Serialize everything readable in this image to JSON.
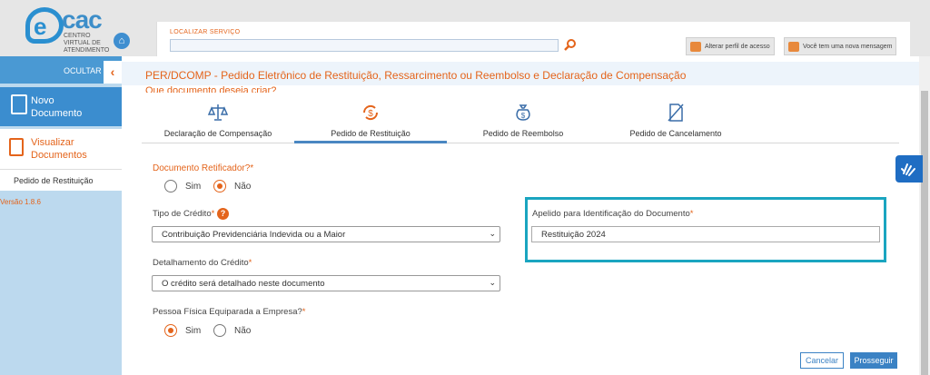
{
  "header": {
    "logo_text": "cac",
    "logo_letter": "e",
    "logo_subtitle": "CENTRO VIRTUAL DE ATENDIMENTO",
    "search_label": "LOCALIZAR SERVIÇO",
    "search_value": "",
    "btn_profile": "Alterar perfil de acesso",
    "btn_message": "Você tem uma nova mensagem"
  },
  "sidebar": {
    "hide_label": "OCULTAR",
    "hide_chevron": "‹",
    "new_doc": "Novo Documento",
    "view_docs": "Visualizar Documentos",
    "current": "Pedido de Restituição",
    "version": "Versão 1.8.6"
  },
  "main": {
    "title": "PER/DCOMP - Pedido Eletrônico de Restituição, Ressarcimento ou Reembolso e Declaração de Compensação",
    "question": "Que documento deseja criar?",
    "tabs": [
      {
        "label": "Declaração de Compensação",
        "icon": "scale-icon",
        "active": false
      },
      {
        "label": "Pedido de Restituição",
        "icon": "refund-icon",
        "active": true
      },
      {
        "label": "Pedido de Reembolso",
        "icon": "money-bag-icon",
        "active": false
      },
      {
        "label": "Pedido de Cancelamento",
        "icon": "cancel-doc-icon",
        "active": false
      }
    ],
    "retificador": {
      "label": "Documento Retificador?",
      "required": "*",
      "options": [
        "Sim",
        "Não"
      ],
      "selected": "Não"
    },
    "tipo_credito": {
      "label": "Tipo de Crédito",
      "required": "*",
      "help": "?",
      "value": "Contribuição Previdenciária Indevida ou a Maior"
    },
    "detalhamento": {
      "label": "Detalhamento do Crédito",
      "required": "*",
      "value": "O crédito será detalhado neste documento"
    },
    "pessoa_fisica": {
      "label": "Pessoa Física Equiparada a Empresa?",
      "required": "*",
      "options": [
        "Sim",
        "Não"
      ],
      "selected": "Sim"
    },
    "apelido": {
      "label": "Apelido para Identificação do Documento",
      "required": "*",
      "value": "Restituição 2024"
    },
    "btn_cancel": "Cancelar",
    "btn_next": "Prosseguir"
  },
  "colors": {
    "accent": "#e4641b",
    "blue": "#3b8dcf",
    "highlight": "#1aa5c0"
  }
}
